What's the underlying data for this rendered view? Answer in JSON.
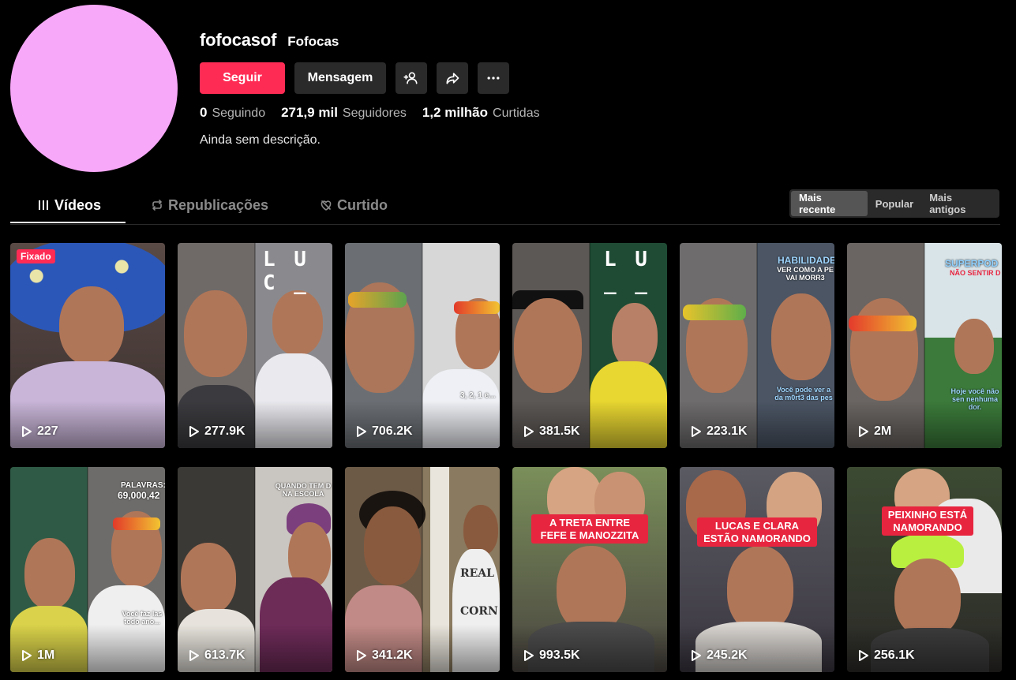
{
  "profile": {
    "username": "fofocasof",
    "nickname": "Fofocas",
    "avatar_color": "#f8a8f8",
    "follow_label": "Seguir",
    "message_label": "Mensagem",
    "icons": [
      "add-friend-icon",
      "share-icon",
      "more-icon"
    ],
    "stats": {
      "following_count": "0",
      "following_label": "Seguindo",
      "followers_count": "271,9 mil",
      "followers_label": "Seguidores",
      "likes_count": "1,2 milhão",
      "likes_label": "Curtidas"
    },
    "bio": "Ainda sem descrição."
  },
  "tabs": [
    {
      "label": "Vídeos",
      "icon": "grid-icon",
      "active": true
    },
    {
      "label": "Republicações",
      "icon": "repost-icon",
      "active": false
    },
    {
      "label": "Curtido",
      "icon": "liked-heart-icon",
      "active": false
    }
  ],
  "sort": [
    {
      "label": "Mais recente",
      "active": true
    },
    {
      "label": "Popular",
      "active": false
    },
    {
      "label": "Mais antigos",
      "active": false
    }
  ],
  "accent_color": "#fe2c55",
  "videos": [
    {
      "views": "227",
      "pinned_label": "Fixado"
    },
    {
      "views": "277.9K",
      "overlay": "L U C _"
    },
    {
      "views": "706.2K",
      "overlay": "3, 2, 1 e..."
    },
    {
      "views": "381.5K",
      "overlay": "L U _ _"
    },
    {
      "views": "223.1K",
      "overlay": "HABILIDADE",
      "overlay2": "VER COMO A PE VAI MORR3",
      "overlay3": "Você pode ver a da m0rt3 das pes"
    },
    {
      "views": "2M",
      "overlay": "SUPERPOD",
      "overlay2": "NÃO SENTIR D",
      "overlay3": "Hoje você não sen nenhuma dor."
    },
    {
      "views": "1M",
      "overlay": "PALAVRAS:",
      "overlay2": "69,000,42",
      "overlay3": "Você faz las todo ano..."
    },
    {
      "views": "613.7K",
      "overlay": "QUANDO TEM D NA ESCOLA"
    },
    {
      "views": "341.2K",
      "overlay": "REAL",
      "overlay2": "CORN"
    },
    {
      "views": "993.5K",
      "caption": "A TRETA ENTRE FEFE E MANOZZITA"
    },
    {
      "views": "245.2K",
      "caption": "LUCAS E CLARA ESTÃO NAMORANDO"
    },
    {
      "views": "256.1K",
      "caption": "PEIXINHO ESTÁ NAMORANDO"
    }
  ]
}
